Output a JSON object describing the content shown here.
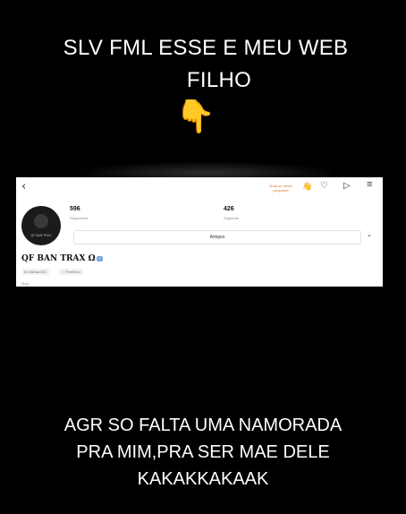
{
  "caption_top": {
    "line1": "SLV FML ESSE E MEU WEB",
    "line2": "FILHO"
  },
  "pointer_emoji": "👇",
  "profile": {
    "back_icon": "‹",
    "notif_text": "Sinta-se nesse psiquiatre",
    "notif_emoji": "👋",
    "heart_icon": "♡",
    "send_icon": "▷",
    "menu_icon": "≡",
    "avatar_tag": "QF BAN TRAX",
    "stats": [
      {
        "value": "596",
        "label": "Seguidores"
      },
      {
        "value": "426",
        "label": "Seguindo"
      }
    ],
    "amigos_label": "Amigos",
    "chevron_icon": "⌄",
    "username": "QF BAN  TRAX Ω",
    "verified_badge": "✓",
    "chips": [
      "ID:U84wk1KG",
      "♀ Feminino"
    ],
    "tiny_text": "Mais"
  },
  "caption_bottom": {
    "line1": "AGR SO FALTA UMA NAMORADA",
    "line2": "PRA MIM,PRA SER MAE DELE",
    "line3": "KAKAKKAKAAK"
  }
}
